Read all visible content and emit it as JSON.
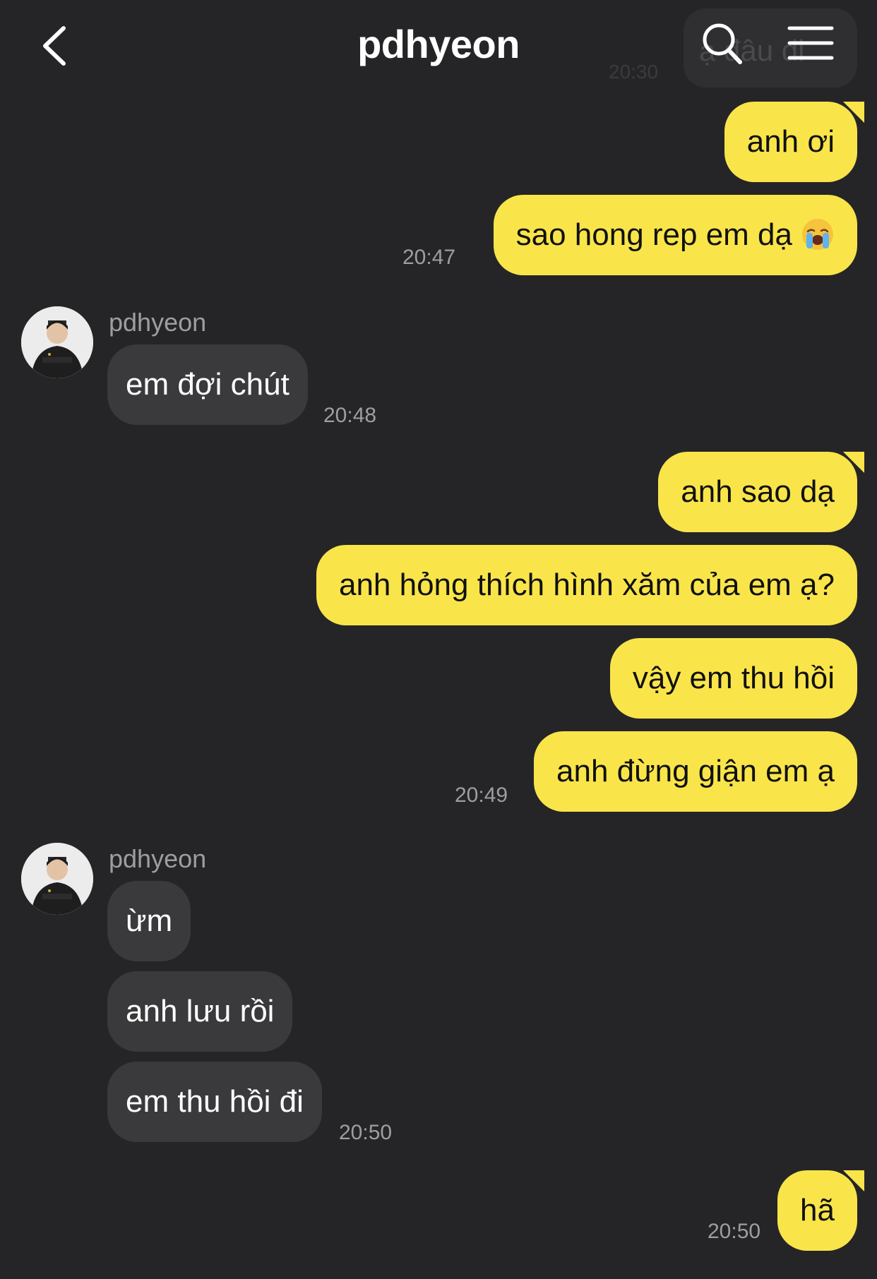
{
  "header": {
    "title": "pdhyeon",
    "ghost_preview_text": "ạ đâu đi",
    "ghost_preview_time": "20:30"
  },
  "contact": {
    "name": "pdhyeon"
  },
  "icons": {
    "back": "chevron-left-icon",
    "search": "search-icon",
    "menu": "hamburger-menu-icon",
    "emoji": "loudly-crying-face-emoji"
  },
  "colors": {
    "background": "#252527",
    "my_bubble": "#f9e54a",
    "their_bubble": "#3a3a3c",
    "timestamp": "#9e9ea2"
  },
  "messages": [
    {
      "from": "me",
      "text": "anh ơi"
    },
    {
      "from": "me",
      "text": "sao hong rep em dạ",
      "emoji": "😭",
      "time": "20:47"
    },
    {
      "from": "them",
      "sender": "pdhyeon",
      "text": "em đợi chút",
      "time": "20:48"
    },
    {
      "from": "me",
      "text": "anh sao dạ"
    },
    {
      "from": "me",
      "text": "anh hỏng thích hình xăm của em ạ?"
    },
    {
      "from": "me",
      "text": "vậy em thu hồi"
    },
    {
      "from": "me",
      "text": "anh đừng giận em ạ",
      "time": "20:49"
    },
    {
      "from": "them",
      "sender": "pdhyeon",
      "text": "ừm"
    },
    {
      "from": "them",
      "text": "anh lưu rồi"
    },
    {
      "from": "them",
      "text": "em thu hồi đi",
      "time": "20:50"
    },
    {
      "from": "me",
      "text": "hã",
      "time": "20:50"
    }
  ]
}
